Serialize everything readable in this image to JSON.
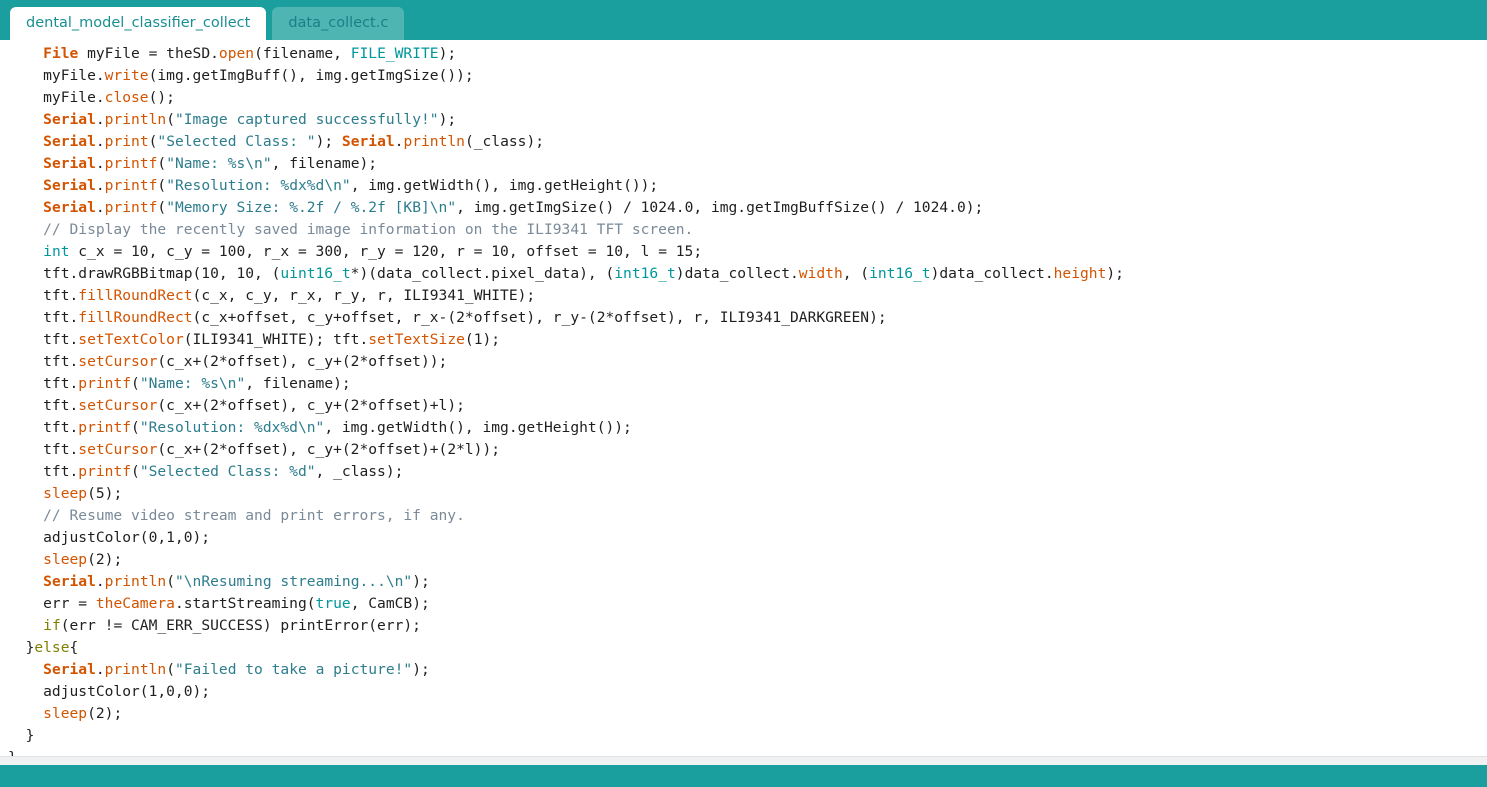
{
  "window": {
    "title": "dental_model_classifier_collect",
    "accent_color": "#1a9e9e",
    "active_tab_bg": "#ffffff",
    "inactive_tab_bg": "#4fb5b3"
  },
  "tabs": [
    {
      "label": "dental_model_classifier_collect",
      "active": true
    },
    {
      "label": "data_collect.c",
      "active": false
    }
  ],
  "editor": {
    "language": "c",
    "colors": {
      "keyword": "#7f7f00",
      "type": "#00979c",
      "function": "#d35400",
      "object": "#d35400",
      "string": "#2d7d8d",
      "comment": "#7a8a99",
      "plain": "#1f1f1f"
    },
    "lines": [
      "    File myFile = theSD.open(filename, FILE_WRITE);",
      "    myFile.write(img.getImgBuff(), img.getImgSize());",
      "    myFile.close();",
      "    Serial.println(\"Image captured successfully!\");",
      "    Serial.print(\"Selected Class: \"); Serial.println(_class);",
      "    Serial.printf(\"Name: %s\\n\", filename);",
      "    Serial.printf(\"Resolution: %dx%d\\n\", img.getWidth(), img.getHeight());",
      "    Serial.printf(\"Memory Size: %.2f / %.2f [KB]\\n\", img.getImgSize() / 1024.0, img.getImgBuffSize() / 1024.0);",
      "    // Display the recently saved image information on the ILI9341 TFT screen.",
      "    int c_x = 10, c_y = 100, r_x = 300, r_y = 120, r = 10, offset = 10, l = 15;",
      "    tft.drawRGBBitmap(10, 10, (uint16_t*)(data_collect.pixel_data), (int16_t)data_collect.width, (int16_t)data_collect.height);",
      "    tft.fillRoundRect(c_x, c_y, r_x, r_y, r, ILI9341_WHITE);",
      "    tft.fillRoundRect(c_x+offset, c_y+offset, r_x-(2*offset), r_y-(2*offset), r, ILI9341_DARKGREEN);",
      "    tft.setTextColor(ILI9341_WHITE); tft.setTextSize(1);",
      "    tft.setCursor(c_x+(2*offset), c_y+(2*offset));",
      "    tft.printf(\"Name: %s\\n\", filename);",
      "    tft.setCursor(c_x+(2*offset), c_y+(2*offset)+l);",
      "    tft.printf(\"Resolution: %dx%d\\n\", img.getWidth(), img.getHeight());",
      "    tft.setCursor(c_x+(2*offset), c_y+(2*offset)+(2*l));",
      "    tft.printf(\"Selected Class: %d\", _class);",
      "    sleep(5);",
      "    // Resume video stream and print errors, if any.",
      "    adjustColor(0,1,0);",
      "    sleep(2);",
      "    Serial.println(\"\\nResuming streaming...\\n\");",
      "    err = theCamera.startStreaming(true, CamCB);",
      "    if(err != CAM_ERR_SUCCESS) printError(err);",
      "  }else{",
      "    Serial.println(\"Failed to take a picture!\");",
      "    adjustColor(1,0,0);",
      "    sleep(2);",
      "  }",
      "}"
    ],
    "tokens": [
      [
        [
          "    ",
          "plain"
        ],
        [
          "File",
          "obj"
        ],
        [
          " myFile = theSD.",
          "plain"
        ],
        [
          "open",
          "func"
        ],
        [
          "(filename, ",
          "plain"
        ],
        [
          "FILE_WRITE",
          "type"
        ],
        [
          ");",
          "plain"
        ]
      ],
      [
        [
          "    myFile.",
          "plain"
        ],
        [
          "write",
          "func"
        ],
        [
          "(img.getImgBuff(), img.getImgSize());",
          "plain"
        ]
      ],
      [
        [
          "    myFile.",
          "plain"
        ],
        [
          "close",
          "func"
        ],
        [
          "();",
          "plain"
        ]
      ],
      [
        [
          "    ",
          "plain"
        ],
        [
          "Serial",
          "obj"
        ],
        [
          ".",
          "plain"
        ],
        [
          "println",
          "func"
        ],
        [
          "(",
          "plain"
        ],
        [
          "\"Image captured successfully!\"",
          "str"
        ],
        [
          ");",
          "plain"
        ]
      ],
      [
        [
          "    ",
          "plain"
        ],
        [
          "Serial",
          "obj"
        ],
        [
          ".",
          "plain"
        ],
        [
          "print",
          "func"
        ],
        [
          "(",
          "plain"
        ],
        [
          "\"Selected Class: \"",
          "str"
        ],
        [
          "); ",
          "plain"
        ],
        [
          "Serial",
          "obj"
        ],
        [
          ".",
          "plain"
        ],
        [
          "println",
          "func"
        ],
        [
          "(_class);",
          "plain"
        ]
      ],
      [
        [
          "    ",
          "plain"
        ],
        [
          "Serial",
          "obj"
        ],
        [
          ".",
          "plain"
        ],
        [
          "printf",
          "func"
        ],
        [
          "(",
          "plain"
        ],
        [
          "\"Name: %s\\n\"",
          "str"
        ],
        [
          ", filename);",
          "plain"
        ]
      ],
      [
        [
          "    ",
          "plain"
        ],
        [
          "Serial",
          "obj"
        ],
        [
          ".",
          "plain"
        ],
        [
          "printf",
          "func"
        ],
        [
          "(",
          "plain"
        ],
        [
          "\"Resolution: %dx%d\\n\"",
          "str"
        ],
        [
          ", img.getWidth(), img.getHeight());",
          "plain"
        ]
      ],
      [
        [
          "    ",
          "plain"
        ],
        [
          "Serial",
          "obj"
        ],
        [
          ".",
          "plain"
        ],
        [
          "printf",
          "func"
        ],
        [
          "(",
          "plain"
        ],
        [
          "\"Memory Size: %.2f / %.2f [KB]\\n\"",
          "str"
        ],
        [
          ", img.getImgSize() / 1024.0, img.getImgBuffSize() / 1024.0);",
          "plain"
        ]
      ],
      [
        [
          "    // Display the recently saved image information on the ILI9341 TFT screen.",
          "cmt"
        ]
      ],
      [
        [
          "    ",
          "plain"
        ],
        [
          "int",
          "type"
        ],
        [
          " c_x = 10, c_y = 100, r_x = 300, r_y = 120, r = 10, offset = 10, l = 15;",
          "plain"
        ]
      ],
      [
        [
          "    tft.drawRGBBitmap(10, 10, (",
          "plain"
        ],
        [
          "uint16_t",
          "type"
        ],
        [
          "*)(data_collect.pixel_data), (",
          "plain"
        ],
        [
          "int16_t",
          "type"
        ],
        [
          ")data_collect.",
          "plain"
        ],
        [
          "width",
          "member"
        ],
        [
          ", (",
          "plain"
        ],
        [
          "int16_t",
          "type"
        ],
        [
          ")data_collect.",
          "plain"
        ],
        [
          "height",
          "member"
        ],
        [
          ");",
          "plain"
        ]
      ],
      [
        [
          "    tft.",
          "plain"
        ],
        [
          "fillRoundRect",
          "func"
        ],
        [
          "(c_x, c_y, r_x, r_y, r, ILI9341_WHITE);",
          "plain"
        ]
      ],
      [
        [
          "    tft.",
          "plain"
        ],
        [
          "fillRoundRect",
          "func"
        ],
        [
          "(c_x+offset, c_y+offset, r_x-(2*offset), r_y-(2*offset), r, ILI9341_DARKGREEN);",
          "plain"
        ]
      ],
      [
        [
          "    tft.",
          "plain"
        ],
        [
          "setTextColor",
          "func"
        ],
        [
          "(ILI9341_WHITE); tft.",
          "plain"
        ],
        [
          "setTextSize",
          "func"
        ],
        [
          "(1);",
          "plain"
        ]
      ],
      [
        [
          "    tft.",
          "plain"
        ],
        [
          "setCursor",
          "func"
        ],
        [
          "(c_x+(2*offset), c_y+(2*offset));",
          "plain"
        ]
      ],
      [
        [
          "    tft.",
          "plain"
        ],
        [
          "printf",
          "func"
        ],
        [
          "(",
          "plain"
        ],
        [
          "\"Name: %s\\n\"",
          "str"
        ],
        [
          ", filename);",
          "plain"
        ]
      ],
      [
        [
          "    tft.",
          "plain"
        ],
        [
          "setCursor",
          "func"
        ],
        [
          "(c_x+(2*offset), c_y+(2*offset)+l);",
          "plain"
        ]
      ],
      [
        [
          "    tft.",
          "plain"
        ],
        [
          "printf",
          "func"
        ],
        [
          "(",
          "plain"
        ],
        [
          "\"Resolution: %dx%d\\n\"",
          "str"
        ],
        [
          ", img.getWidth(), img.getHeight());",
          "plain"
        ]
      ],
      [
        [
          "    tft.",
          "plain"
        ],
        [
          "setCursor",
          "func"
        ],
        [
          "(c_x+(2*offset), c_y+(2*offset)+(2*l));",
          "plain"
        ]
      ],
      [
        [
          "    tft.",
          "plain"
        ],
        [
          "printf",
          "func"
        ],
        [
          "(",
          "plain"
        ],
        [
          "\"Selected Class: %d\"",
          "str"
        ],
        [
          ", _class);",
          "plain"
        ]
      ],
      [
        [
          "    ",
          "plain"
        ],
        [
          "sleep",
          "func"
        ],
        [
          "(5);",
          "plain"
        ]
      ],
      [
        [
          "    // Resume video stream and print errors, if any.",
          "cmt"
        ]
      ],
      [
        [
          "    adjustColor(0,1,0);",
          "plain"
        ]
      ],
      [
        [
          "    ",
          "plain"
        ],
        [
          "sleep",
          "func"
        ],
        [
          "(2);",
          "plain"
        ]
      ],
      [
        [
          "    ",
          "plain"
        ],
        [
          "Serial",
          "obj"
        ],
        [
          ".",
          "plain"
        ],
        [
          "println",
          "func"
        ],
        [
          "(",
          "plain"
        ],
        [
          "\"\\nResuming streaming...\\n\"",
          "str"
        ],
        [
          ");",
          "plain"
        ]
      ],
      [
        [
          "    err = ",
          "plain"
        ],
        [
          "theCamera",
          "func"
        ],
        [
          ".startStreaming(",
          "plain"
        ],
        [
          "true",
          "lit"
        ],
        [
          ", CamCB);",
          "plain"
        ]
      ],
      [
        [
          "    ",
          "plain"
        ],
        [
          "if",
          "kw"
        ],
        [
          "(err != CAM_ERR_SUCCESS) printError(err);",
          "plain"
        ]
      ],
      [
        [
          "  }",
          "plain"
        ],
        [
          "else",
          "kw"
        ],
        [
          "{",
          "plain"
        ]
      ],
      [
        [
          "    ",
          "plain"
        ],
        [
          "Serial",
          "obj"
        ],
        [
          ".",
          "plain"
        ],
        [
          "println",
          "func"
        ],
        [
          "(",
          "plain"
        ],
        [
          "\"Failed to take a picture!\"",
          "str"
        ],
        [
          ");",
          "plain"
        ]
      ],
      [
        [
          "    adjustColor(1,0,0);",
          "plain"
        ]
      ],
      [
        [
          "    ",
          "plain"
        ],
        [
          "sleep",
          "func"
        ],
        [
          "(2);",
          "plain"
        ]
      ],
      [
        [
          "  }",
          "plain"
        ]
      ],
      [
        [
          "}",
          "plain"
        ]
      ]
    ]
  },
  "statusbar": {
    "text": ""
  }
}
